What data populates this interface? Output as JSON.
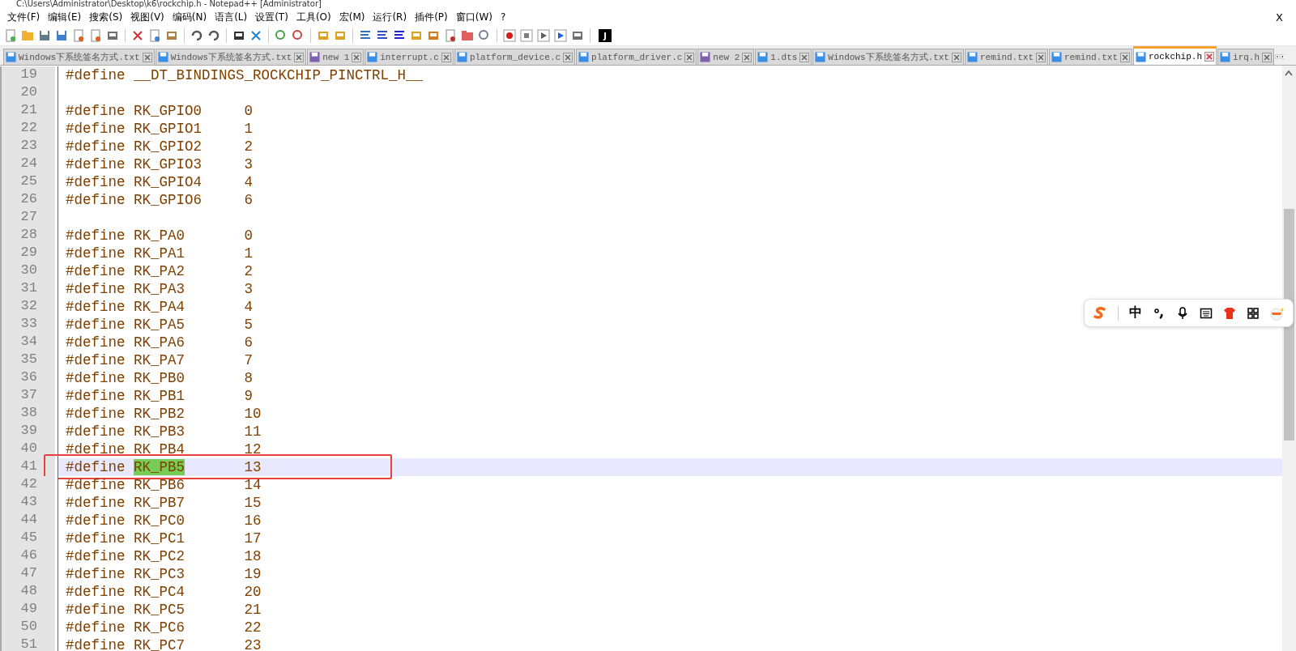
{
  "window": {
    "title": "C:\\Users\\Administrator\\Desktop\\k6\\rockchip.h - Notepad++ [Administrator]",
    "close": "X"
  },
  "menu": [
    "文件(F)",
    "编辑(E)",
    "搜索(S)",
    "视图(V)",
    "编码(N)",
    "语言(L)",
    "设置(T)",
    "工具(O)",
    "宏(M)",
    "运行(R)",
    "插件(P)",
    "窗口(W)",
    "?"
  ],
  "toolbar": {
    "last_button": "J"
  },
  "tabs": [
    {
      "label": "Windows下系统签名方式.txt",
      "unsaved": false,
      "selected": false
    },
    {
      "label": "Windows下系统签名方式.txt",
      "unsaved": false,
      "selected": false
    },
    {
      "label": "new 1",
      "unsaved": true,
      "selected": false
    },
    {
      "label": "interrupt.c",
      "unsaved": false,
      "selected": false
    },
    {
      "label": "platform_device.c",
      "unsaved": false,
      "selected": false
    },
    {
      "label": "platform_driver.c",
      "unsaved": false,
      "selected": false
    },
    {
      "label": "new 2",
      "unsaved": true,
      "selected": false
    },
    {
      "label": "1.dts",
      "unsaved": false,
      "selected": false
    },
    {
      "label": "Windows下系统签名方式.txt",
      "unsaved": false,
      "selected": false
    },
    {
      "label": "remind.txt",
      "unsaved": false,
      "selected": false
    },
    {
      "label": "remind.txt",
      "unsaved": false,
      "selected": false
    },
    {
      "label": "rockchip.h",
      "unsaved": false,
      "selected": true
    },
    {
      "label": "irq.h",
      "unsaved": false,
      "selected": false
    }
  ],
  "lines": [
    {
      "number": "19",
      "directive": "#define",
      "name": "__DT_BINDINGS_ROCKCHIP_PINCTRL_H__",
      "current": false,
      "marked": false
    },
    {
      "number": "20",
      "current": false,
      "marked": false
    },
    {
      "number": "21",
      "directive": "#define",
      "name": "RK_GPIO0",
      "value": "0",
      "current": false,
      "marked": false
    },
    {
      "number": "22",
      "directive": "#define",
      "name": "RK_GPIO1",
      "value": "1",
      "current": false,
      "marked": false
    },
    {
      "number": "23",
      "directive": "#define",
      "name": "RK_GPIO2",
      "value": "2",
      "current": false,
      "marked": false
    },
    {
      "number": "24",
      "directive": "#define",
      "name": "RK_GPIO3",
      "value": "3",
      "current": false,
      "marked": false
    },
    {
      "number": "25",
      "directive": "#define",
      "name": "RK_GPIO4",
      "value": "4",
      "current": false,
      "marked": false
    },
    {
      "number": "26",
      "directive": "#define",
      "name": "RK_GPIO6",
      "value": "6",
      "current": false,
      "marked": false
    },
    {
      "number": "27",
      "current": false,
      "marked": false
    },
    {
      "number": "28",
      "directive": "#define",
      "name": "RK_PA0",
      "value": "0",
      "current": false,
      "marked": false
    },
    {
      "number": "29",
      "directive": "#define",
      "name": "RK_PA1",
      "value": "1",
      "current": false,
      "marked": false
    },
    {
      "number": "30",
      "directive": "#define",
      "name": "RK_PA2",
      "value": "2",
      "current": false,
      "marked": false
    },
    {
      "number": "31",
      "directive": "#define",
      "name": "RK_PA3",
      "value": "3",
      "current": false,
      "marked": false
    },
    {
      "number": "32",
      "directive": "#define",
      "name": "RK_PA4",
      "value": "4",
      "current": false,
      "marked": false
    },
    {
      "number": "33",
      "directive": "#define",
      "name": "RK_PA5",
      "value": "5",
      "current": false,
      "marked": false
    },
    {
      "number": "34",
      "directive": "#define",
      "name": "RK_PA6",
      "value": "6",
      "current": false,
      "marked": false
    },
    {
      "number": "35",
      "directive": "#define",
      "name": "RK_PA7",
      "value": "7",
      "current": false,
      "marked": false
    },
    {
      "number": "36",
      "directive": "#define",
      "name": "RK_PB0",
      "value": "8",
      "current": false,
      "marked": false
    },
    {
      "number": "37",
      "directive": "#define",
      "name": "RK_PB1",
      "value": "9",
      "current": false,
      "marked": false
    },
    {
      "number": "38",
      "directive": "#define",
      "name": "RK_PB2",
      "value": "10",
      "current": false,
      "marked": false
    },
    {
      "number": "39",
      "directive": "#define",
      "name": "RK_PB3",
      "value": "11",
      "current": false,
      "marked": false
    },
    {
      "number": "40",
      "directive": "#define",
      "name": "RK_PB4",
      "value": "12",
      "current": false,
      "marked": false
    },
    {
      "number": "41",
      "directive": "#define",
      "name": "RK_PB5",
      "value": "13",
      "current": true,
      "marked": true
    },
    {
      "number": "42",
      "directive": "#define",
      "name": "RK_PB6",
      "value": "14",
      "current": false,
      "marked": false
    },
    {
      "number": "43",
      "directive": "#define",
      "name": "RK_PB7",
      "value": "15",
      "current": false,
      "marked": false
    },
    {
      "number": "44",
      "directive": "#define",
      "name": "RK_PC0",
      "value": "16",
      "current": false,
      "marked": false
    },
    {
      "number": "45",
      "directive": "#define",
      "name": "RK_PC1",
      "value": "17",
      "current": false,
      "marked": false
    },
    {
      "number": "46",
      "directive": "#define",
      "name": "RK_PC2",
      "value": "18",
      "current": false,
      "marked": false
    },
    {
      "number": "47",
      "directive": "#define",
      "name": "RK_PC3",
      "value": "19",
      "current": false,
      "marked": false
    },
    {
      "number": "48",
      "directive": "#define",
      "name": "RK_PC4",
      "value": "20",
      "current": false,
      "marked": false
    },
    {
      "number": "49",
      "directive": "#define",
      "name": "RK_PC5",
      "value": "21",
      "current": false,
      "marked": false
    },
    {
      "number": "50",
      "directive": "#define",
      "name": "RK_PC6",
      "value": "22",
      "current": false,
      "marked": false
    },
    {
      "number": "51",
      "directive": "#define",
      "name": "RK_PC7",
      "value": "23",
      "current": false,
      "marked": false
    }
  ],
  "ime_toolbar": {
    "mode": "中"
  }
}
